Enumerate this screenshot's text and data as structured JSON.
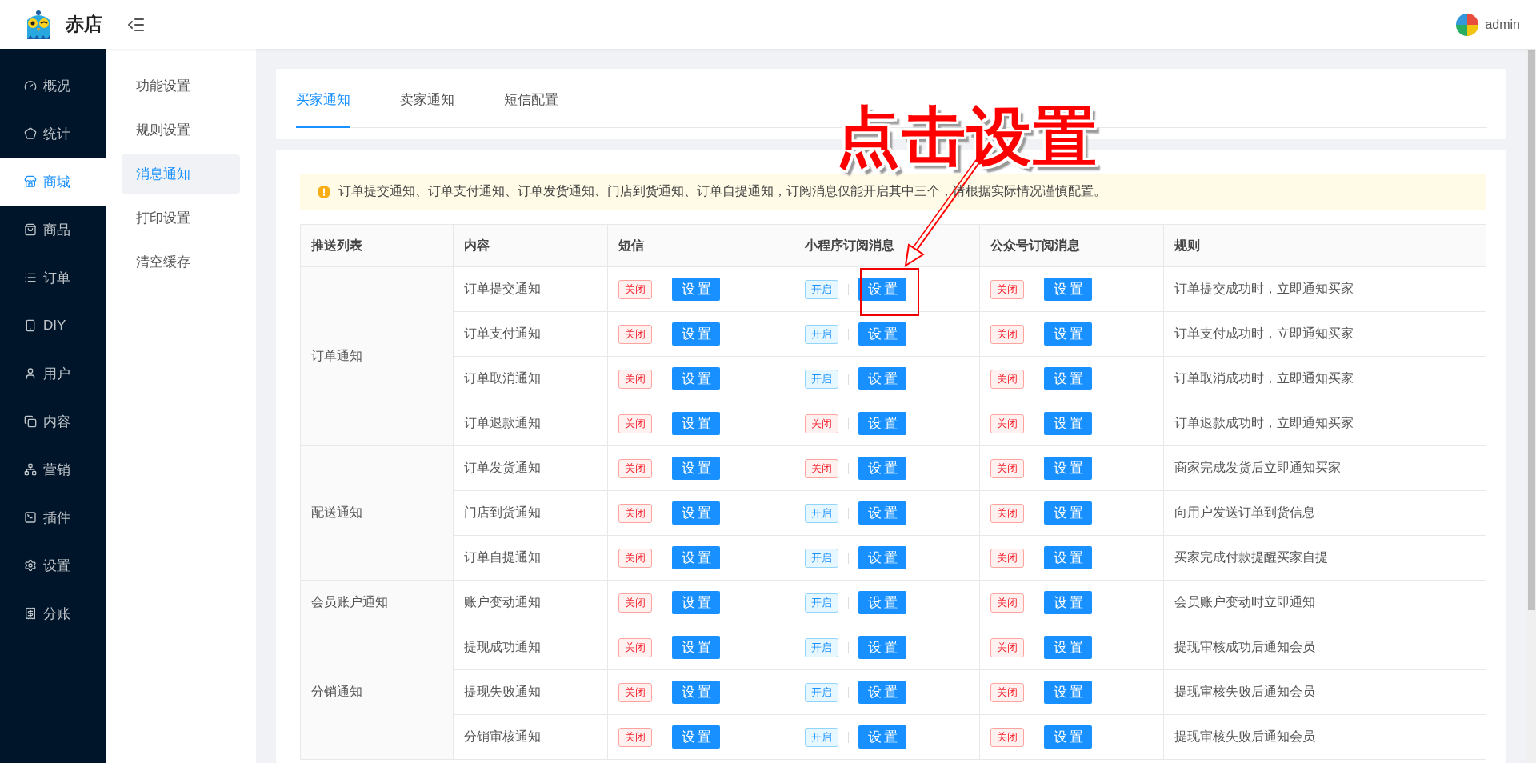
{
  "header": {
    "brand": "赤店",
    "user": "admin"
  },
  "sidebar": {
    "items": [
      {
        "label": "概况",
        "selected": false
      },
      {
        "label": "统计",
        "selected": false
      },
      {
        "label": "商城",
        "selected": true
      },
      {
        "label": "商品",
        "selected": false
      },
      {
        "label": "订单",
        "selected": false
      },
      {
        "label": "DIY",
        "selected": false
      },
      {
        "label": "用户",
        "selected": false
      },
      {
        "label": "内容",
        "selected": false
      },
      {
        "label": "营销",
        "selected": false
      },
      {
        "label": "插件",
        "selected": false
      },
      {
        "label": "设置",
        "selected": false
      },
      {
        "label": "分账",
        "selected": false
      }
    ]
  },
  "submenu": {
    "items": [
      {
        "label": "功能设置",
        "selected": false
      },
      {
        "label": "规则设置",
        "selected": false
      },
      {
        "label": "消息通知",
        "selected": true
      },
      {
        "label": "打印设置",
        "selected": false
      },
      {
        "label": "清空缓存",
        "selected": false
      }
    ]
  },
  "tabs": [
    {
      "label": "买家通知",
      "selected": true
    },
    {
      "label": "卖家通知",
      "selected": false
    },
    {
      "label": "短信配置",
      "selected": false
    }
  ],
  "alert": {
    "text": "订单提交通知、订单支付通知、订单发货通知、门店到货通知、订单自提通知，订阅消息仅能开启其中三个，请根据实际情况谨慎配置。"
  },
  "table": {
    "columns": [
      "推送列表",
      "内容",
      "短信",
      "小程序订阅消息",
      "公众号订阅消息",
      "规则"
    ],
    "groups": [
      {
        "name": "订单通知",
        "rows": [
          {
            "content": "订单提交通知",
            "sms": {
              "status": "关闭",
              "on": false,
              "button": "设置"
            },
            "mini": {
              "status": "开启",
              "on": true,
              "button": "设置"
            },
            "official": {
              "status": "关闭",
              "on": false,
              "button": "设置"
            },
            "rule": "订单提交成功时，立即通知买家"
          },
          {
            "content": "订单支付通知",
            "sms": {
              "status": "关闭",
              "on": false,
              "button": "设置"
            },
            "mini": {
              "status": "开启",
              "on": true,
              "button": "设置"
            },
            "official": {
              "status": "关闭",
              "on": false,
              "button": "设置"
            },
            "rule": "订单支付成功时，立即通知买家"
          },
          {
            "content": "订单取消通知",
            "sms": {
              "status": "关闭",
              "on": false,
              "button": "设置"
            },
            "mini": {
              "status": "开启",
              "on": true,
              "button": "设置"
            },
            "official": {
              "status": "关闭",
              "on": false,
              "button": "设置"
            },
            "rule": "订单取消成功时，立即通知买家"
          },
          {
            "content": "订单退款通知",
            "sms": {
              "status": "关闭",
              "on": false,
              "button": "设置"
            },
            "mini": {
              "status": "关闭",
              "on": false,
              "button": "设置"
            },
            "official": {
              "status": "关闭",
              "on": false,
              "button": "设置"
            },
            "rule": "订单退款成功时，立即通知买家"
          }
        ]
      },
      {
        "name": "配送通知",
        "rows": [
          {
            "content": "订单发货通知",
            "sms": {
              "status": "关闭",
              "on": false,
              "button": "设置"
            },
            "mini": {
              "status": "关闭",
              "on": false,
              "button": "设置"
            },
            "official": {
              "status": "关闭",
              "on": false,
              "button": "设置"
            },
            "rule": "商家完成发货后立即通知买家"
          },
          {
            "content": "门店到货通知",
            "sms": {
              "status": "关闭",
              "on": false,
              "button": "设置"
            },
            "mini": {
              "status": "开启",
              "on": true,
              "button": "设置"
            },
            "official": {
              "status": "关闭",
              "on": false,
              "button": "设置"
            },
            "rule": "向用户发送订单到货信息"
          },
          {
            "content": "订单自提通知",
            "sms": {
              "status": "关闭",
              "on": false,
              "button": "设置"
            },
            "mini": {
              "status": "开启",
              "on": true,
              "button": "设置"
            },
            "official": {
              "status": "关闭",
              "on": false,
              "button": "设置"
            },
            "rule": "买家完成付款提醒买家自提"
          }
        ]
      },
      {
        "name": "会员账户通知",
        "rows": [
          {
            "content": "账户变动通知",
            "sms": {
              "status": "关闭",
              "on": false,
              "button": "设置"
            },
            "mini": {
              "status": "开启",
              "on": true,
              "button": "设置"
            },
            "official": {
              "status": "关闭",
              "on": false,
              "button": "设置"
            },
            "rule": "会员账户变动时立即通知"
          }
        ]
      },
      {
        "name": "分销通知",
        "rows": [
          {
            "content": "提现成功通知",
            "sms": {
              "status": "关闭",
              "on": false,
              "button": "设置"
            },
            "mini": {
              "status": "开启",
              "on": true,
              "button": "设置"
            },
            "official": {
              "status": "关闭",
              "on": false,
              "button": "设置"
            },
            "rule": "提现审核成功后通知会员"
          },
          {
            "content": "提现失败通知",
            "sms": {
              "status": "关闭",
              "on": false,
              "button": "设置"
            },
            "mini": {
              "status": "开启",
              "on": true,
              "button": "设置"
            },
            "official": {
              "status": "关闭",
              "on": false,
              "button": "设置"
            },
            "rule": "提现审核失败后通知会员"
          },
          {
            "content": "分销审核通知",
            "sms": {
              "status": "关闭",
              "on": false,
              "button": "设置"
            },
            "mini": {
              "status": "开启",
              "on": true,
              "button": "设置"
            },
            "official": {
              "status": "关闭",
              "on": false,
              "button": "设置"
            },
            "rule": "提现审核失败后通知会员"
          }
        ]
      }
    ]
  },
  "annotation": {
    "text": "点击设置"
  }
}
